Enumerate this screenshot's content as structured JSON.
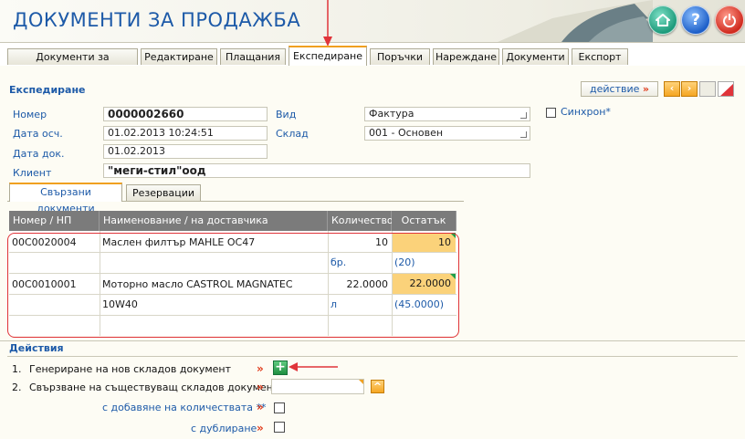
{
  "header": {
    "title": "ДОКУМЕНТИ ЗА ПРОДАЖБА",
    "buttons": [
      "home-icon",
      "help-icon",
      "power-icon"
    ],
    "help_glyph": "?"
  },
  "tabs": [
    "Документи за продажба",
    "Редактиране",
    "Плащания",
    "Експедиране",
    "Поръчки",
    "Нареждане",
    "Документи",
    "Експорт"
  ],
  "active_tab": "Експедиране",
  "section": {
    "title": "Експедиране",
    "action_label": "действие",
    "action_marker": "»"
  },
  "form": {
    "nomer_label": "Номер",
    "nomer_value": "0000002660",
    "data_osch_label": "Дата осч.",
    "data_osch_value": "01.02.2013 10:24:51",
    "data_dok_label": "Дата док.",
    "data_dok_value": "01.02.2013",
    "klient_label": "Клиент",
    "klient_value": "\"меги-стил\"оод",
    "vid_label": "Вид",
    "vid_value": "Фактура",
    "sklad_label": "Склад",
    "sklad_value": "001 - Основен",
    "sinhron_label": "Синхрон*"
  },
  "subtabs": [
    "Свързани документи",
    "Резервации"
  ],
  "grid": {
    "columns": [
      "Номер / НП",
      "Наименование / на доставчика",
      "Количество",
      "Остатък"
    ],
    "rows": [
      {
        "code": "00C0020004",
        "name": "Маслен филтър MAHLE OC47",
        "qty": "10",
        "rest": "10",
        "unit": "бр.",
        "rest_sub": "(20)"
      },
      {
        "code": "00C0010001",
        "name": "Моторно масло CASTROL MAGNATEC 10W40",
        "qty": "22.0000",
        "rest": "22.0000",
        "unit": "л",
        "rest_sub": "(45.0000)"
      }
    ]
  },
  "actions": {
    "title": "Действия",
    "item1_num": "1.",
    "item1": "Генериране на нов складов документ",
    "item2_num": "2.",
    "item2": "Свързване на съществуващ складов документ",
    "opt_add_qty": "с добавяне на количествата **",
    "opt_dup": "с дублиране",
    "marker": "»",
    "plus": "+"
  },
  "colors": {
    "accent": "#1d5aa8",
    "orange": "#f5a623",
    "highlight": "#fbd27a",
    "annotation_red": "#e0343a"
  }
}
